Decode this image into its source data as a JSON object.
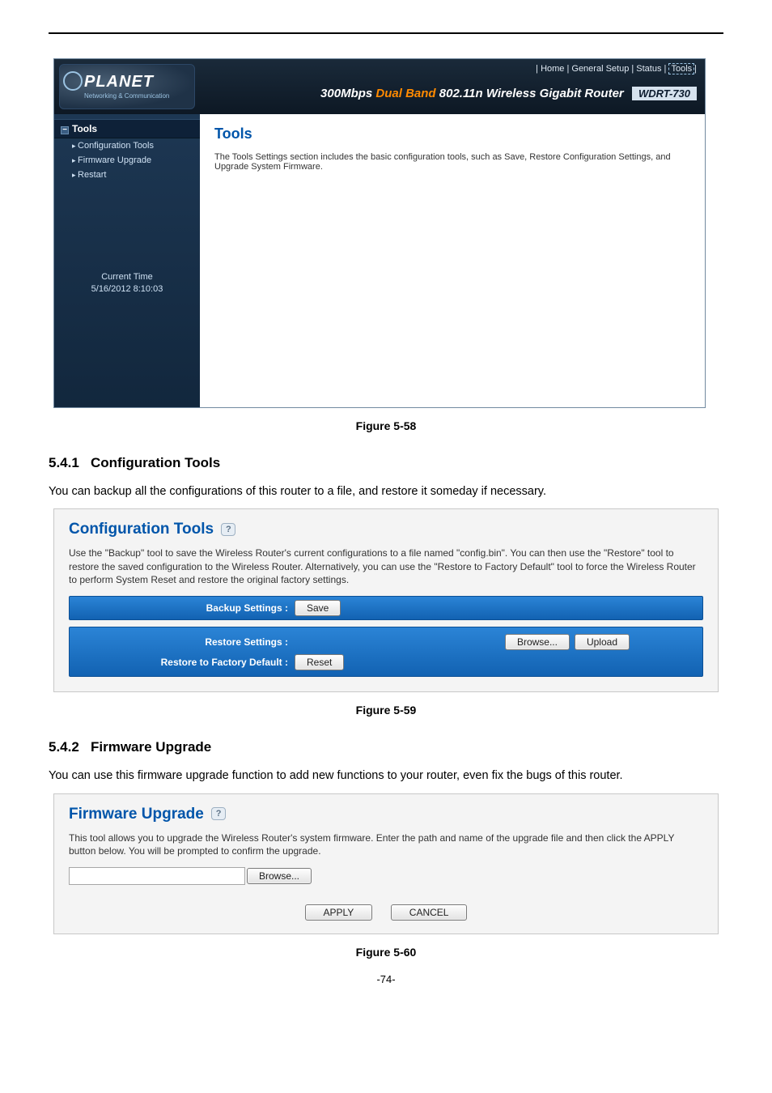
{
  "router": {
    "logoText": "PLANET",
    "logoSub": "Networking & Communication",
    "headerLinks": "| Home | General Setup | Status |",
    "headerLinkActive": "Tools",
    "headerTitlePrefix": "300Mbps ",
    "headerTitleOrange": "Dual Band",
    "headerTitleSuffix": " 802.11n Wireless Gigabit Router",
    "modelBadge": "WDRT-730",
    "sidebar": {
      "group": "Tools",
      "items": [
        "Configuration Tools",
        "Firmware Upgrade",
        "Restart"
      ],
      "currentTimeLabel": "Current Time",
      "currentTimeValue": "5/16/2012 8:10:03"
    },
    "mainTitle": "Tools",
    "mainDesc": "The Tools Settings section includes the basic configuration tools, such as Save, Restore Configuration Settings, and Upgrade System Firmware."
  },
  "fig58": "Figure 5-58",
  "sec541": {
    "num": "5.4.1",
    "title": "Configuration Tools"
  },
  "para541": "You can backup all the configurations of this router to a file, and restore it someday if necessary.",
  "cfgPanel": {
    "title": "Configuration Tools",
    "help": "?",
    "desc": "Use the \"Backup\" tool to save the Wireless Router's current configurations to a file named \"config.bin\". You can then use the \"Restore\" tool to restore the saved configuration to the Wireless Router. Alternatively, you can use the \"Restore to Factory Default\" tool to force the Wireless Router to perform System Reset and restore the original factory settings.",
    "backupLabel": "Backup Settings :",
    "saveBtn": "Save",
    "restoreLabel": "Restore Settings :",
    "browseBtn": "Browse...",
    "uploadBtn": "Upload",
    "factoryLabel": "Restore to Factory Default :",
    "resetBtn": "Reset"
  },
  "fig59": "Figure 5-59",
  "sec542": {
    "num": "5.4.2",
    "title": "Firmware Upgrade"
  },
  "para542": "You can use this firmware upgrade function to add new functions to your router, even fix the bugs of this router.",
  "fwPanel": {
    "title": "Firmware Upgrade",
    "help": "?",
    "desc": "This tool allows you to upgrade the Wireless Router's system firmware. Enter the path and name of the upgrade file and then click the APPLY button below. You will be prompted to confirm the upgrade.",
    "browseBtn": "Browse...",
    "applyBtn": "APPLY",
    "cancelBtn": "CANCEL"
  },
  "fig60": "Figure 5-60",
  "pageNum": "-74-"
}
